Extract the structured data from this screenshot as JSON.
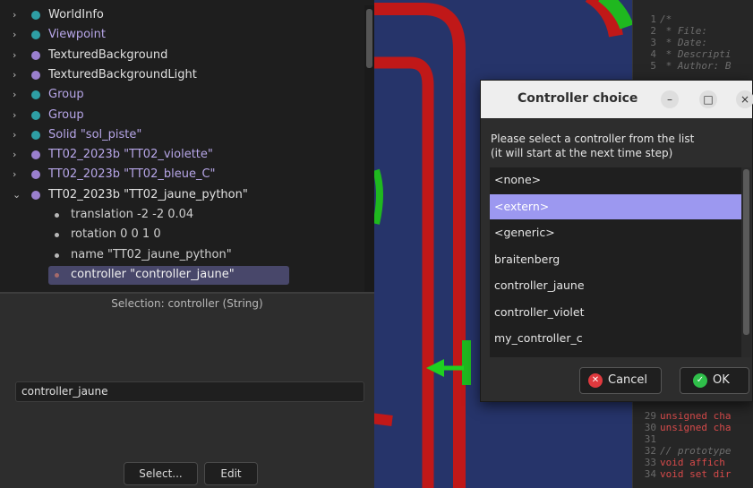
{
  "scene_tree": {
    "nodes": [
      {
        "label": "WorldInfo",
        "color": "teal",
        "text_color": "gray"
      },
      {
        "label": "Viewpoint",
        "color": "teal",
        "text_color": "purple"
      },
      {
        "label": "TexturedBackground",
        "color": "purple",
        "text_color": "gray"
      },
      {
        "label": "TexturedBackgroundLight",
        "color": "purple",
        "text_color": "gray"
      },
      {
        "label": "Group",
        "color": "teal",
        "text_color": "purple"
      },
      {
        "label": "Group",
        "color": "teal",
        "text_color": "purple"
      },
      {
        "label": "Solid \"sol_piste\"",
        "color": "teal",
        "text_color": "purple"
      },
      {
        "label": "TT02_2023b \"TT02_violette\"",
        "color": "purple",
        "text_color": "purple"
      },
      {
        "label": "TT02_2023b \"TT02_bleue_C\"",
        "color": "purple",
        "text_color": "purple"
      },
      {
        "label": "TT02_2023b \"TT02_jaune_python\"",
        "color": "purple",
        "text_color": "gray"
      }
    ],
    "fields": [
      {
        "label": "translation -2 -2 0.04"
      },
      {
        "label": "rotation 0 0 1 0"
      },
      {
        "label": "name \"TT02_jaune_python\""
      },
      {
        "label": "controller \"controller_jaune\""
      }
    ]
  },
  "field_editor": {
    "selection_title": "Selection: controller (String)",
    "value": "controller_jaune",
    "select_label": "Select...",
    "edit_label": "Edit"
  },
  "code_editor": {
    "lines": [
      {
        "n": "1",
        "kind": "cm",
        "text": "/*"
      },
      {
        "n": "2",
        "kind": "cm",
        "text": " * File:"
      },
      {
        "n": "3",
        "kind": "cm",
        "text": " * Date:"
      },
      {
        "n": "4",
        "kind": "cm",
        "text": " * Descripti"
      },
      {
        "n": "5",
        "kind": "cm",
        "text": " * Author: B"
      },
      {
        "n": "29",
        "kind": "kw",
        "text": "unsigned cha"
      },
      {
        "n": "30",
        "kind": "kw",
        "text": "unsigned cha"
      },
      {
        "n": "31",
        "kind": "tx",
        "text": ""
      },
      {
        "n": "32",
        "kind": "cm",
        "text": "// prototype"
      },
      {
        "n": "33",
        "kind": "kw",
        "text": "void affich"
      },
      {
        "n": "34",
        "kind": "kw",
        "text": "void set dir"
      }
    ]
  },
  "dialog": {
    "title": "Controller choice",
    "minimize_glyph": "–",
    "maximize_glyph": "□",
    "close_glyph": "×",
    "message_line1": "Please select a controller from the list",
    "message_line2": "(it will start at the next time step)",
    "items": [
      "<none>",
      "<extern>",
      "<generic>",
      "braitenberg",
      "controller_jaune",
      "controller_violet",
      "my_controller_c"
    ],
    "selected": "<extern>",
    "cancel_label": "Cancel",
    "ok_label": "OK"
  },
  "colors": {
    "teal_node": "#2e9ea4",
    "purple_node": "#9a7fce",
    "selected_item": "#9c98f0",
    "scene_background": "#26346a",
    "track_red": "#c01818",
    "track_green": "#1fb81f",
    "cancel_icon": "#e0393e",
    "ok_icon": "#2fbf4a"
  },
  "icons": {
    "collapsed": "chevron-right-icon",
    "expanded": "chevron-down-icon",
    "cancel": "x-circle-icon",
    "ok": "check-circle-icon"
  }
}
